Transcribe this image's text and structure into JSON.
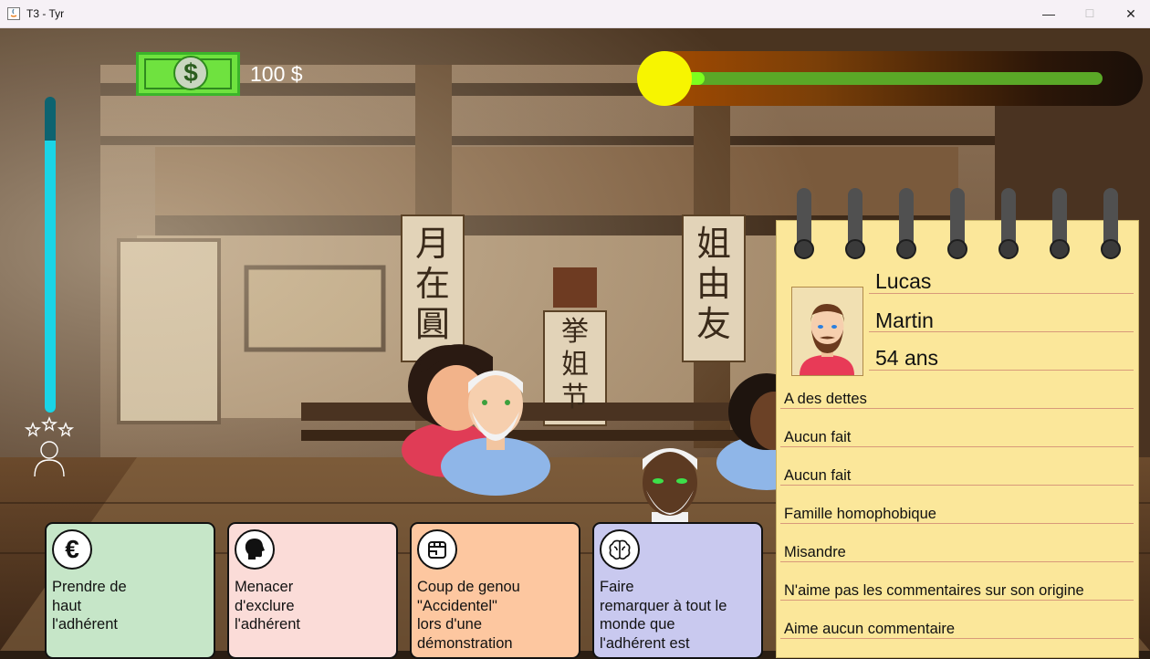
{
  "window": {
    "title": "T3 - Tyr",
    "minimize": "—",
    "maximize": "☐",
    "close": "✕"
  },
  "hud": {
    "money": "100 $",
    "money_symbol": "$",
    "progress_fraction": 0.1,
    "meter_fraction": 0.86
  },
  "actions": [
    {
      "label": "Prendre de\nhaut\nl'adhérent",
      "color": "#c6e6c8",
      "icon": "euro-icon"
    },
    {
      "label": "Menacer\nd'exclure\nl'adhérent",
      "color": "#fbdcd8",
      "icon": "speaking-head-icon"
    },
    {
      "label": "Coup de genou\n\"Accidentel\"\nlors d'une\ndémonstration",
      "color": "#fdc7a0",
      "icon": "fist-icon"
    },
    {
      "label": "Faire\nremarquer à tout le\nmonde que\nl'adhérent est",
      "color": "#c9c9ef",
      "icon": "brain-icon"
    }
  ],
  "euro_symbol": "€",
  "notebook": {
    "first_name": "Lucas",
    "last_name": "Martin",
    "age": "54 ans",
    "traits": [
      "A des dettes",
      "Aucun fait",
      "Aucun fait",
      "Famille homophobique",
      "Misandre",
      "N'aime pas les commentaires sur son origine",
      "Aime aucun commentaire"
    ]
  },
  "dojo_scrolls": {
    "left": "月在圓",
    "right": "姐由友",
    "center": "挙姐节"
  }
}
